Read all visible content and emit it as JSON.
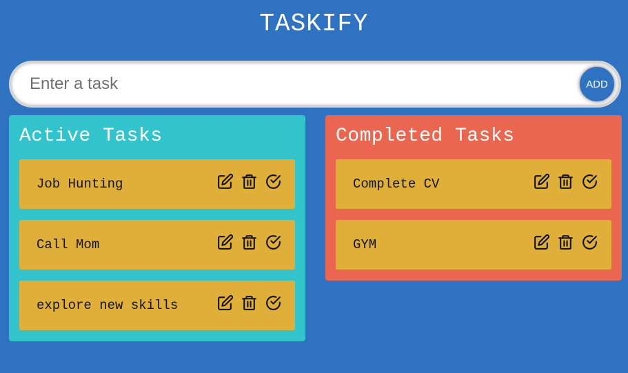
{
  "app": {
    "title": "TASKIFY"
  },
  "form": {
    "placeholder": "Enter a task",
    "value": "",
    "add_label": "ADD"
  },
  "active": {
    "heading": "Active Tasks",
    "tasks": [
      {
        "text": "Job Hunting"
      },
      {
        "text": "Call Mom"
      },
      {
        "text": "explore new skills"
      }
    ]
  },
  "completed": {
    "heading": "Completed Tasks",
    "tasks": [
      {
        "text": "Complete CV"
      },
      {
        "text": "GYM"
      }
    ]
  },
  "icons": {
    "edit": "edit-icon",
    "delete": "trash-icon",
    "done": "check-circle-icon"
  },
  "colors": {
    "background": "#2f72c1",
    "active_panel": "#32c3cc",
    "completed_panel": "#eb6650",
    "task_card": "#e0af3a",
    "add_button": "#2f72c1"
  }
}
